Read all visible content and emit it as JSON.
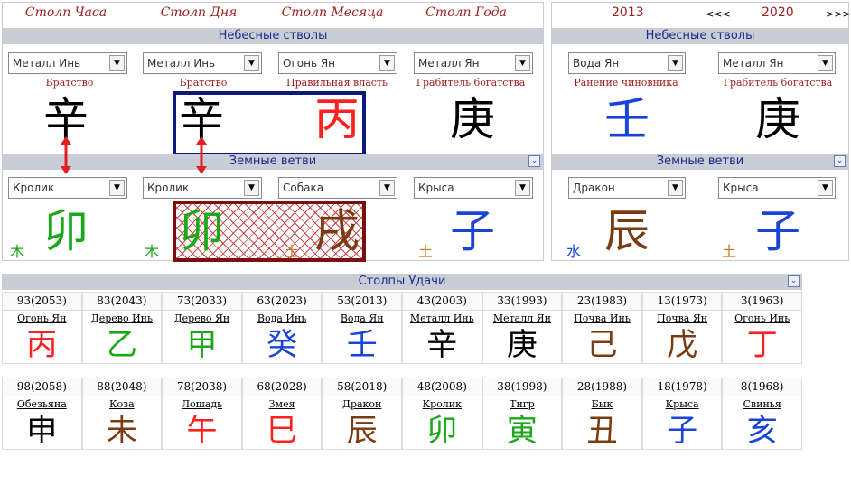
{
  "colors": {
    "header_bg": "#c9ced6",
    "title_red": "#a01e1e",
    "metal": "#000000",
    "fire": "#ff2020",
    "water": "#1a44d8",
    "wood": "#18a818",
    "earth": "#7a3b12"
  },
  "natal": {
    "pillars": [
      {
        "title": "Столп Часа",
        "stem_select": "Металл Инь",
        "god": "Братство",
        "stem_char": "辛",
        "stem_color": "#000000",
        "branch_select": "Кролик",
        "branch_char": "卯",
        "branch_color": "#18a818",
        "hidden": "木",
        "hidden_color": "#18a818"
      },
      {
        "title": "Столп Дня",
        "stem_select": "Металл Инь",
        "god": "Братство",
        "stem_char": "辛",
        "stem_color": "#000000",
        "branch_select": "Кролик",
        "branch_char": "卯",
        "branch_color": "#18a818",
        "hidden": "木",
        "hidden_color": "#18a818"
      },
      {
        "title": "Столп Месяца",
        "stem_select": "Огонь Ян",
        "god": "Правильная власть",
        "stem_char": "丙",
        "stem_color": "#ff2020",
        "branch_select": "Собака",
        "branch_char": "戌",
        "branch_color": "#7a3b12",
        "hidden": "土",
        "hidden_color": "#c07a18"
      },
      {
        "title": "Столп Года",
        "stem_select": "Металл Ян",
        "god": "Грабитель богатства",
        "stem_char": "庚",
        "stem_color": "#000000",
        "branch_select": "Крыса",
        "branch_char": "子",
        "branch_color": "#1a44d8",
        "hidden": "土",
        "hidden_color": "#c07a18"
      }
    ],
    "heavenly_header": "Небесные стволы",
    "earthly_header": "Земные ветви"
  },
  "annual": {
    "year_left": "2013",
    "nav_prev": "<<<",
    "year_right": "2020",
    "nav_next": ">>>",
    "heavenly_header": "Небесные стволы",
    "earthly_header": "Земные ветви",
    "pillars": [
      {
        "stem_select": "Вода Ян",
        "god": "Ранение чиновника",
        "stem_char": "壬",
        "stem_color": "#1a44d8",
        "branch_select": "Дракон",
        "branch_char": "辰",
        "branch_color": "#7a3b12",
        "hidden": "水",
        "hidden_color": "#1a44d8"
      },
      {
        "stem_select": "Металл Ян",
        "god": "Грабитель богатства",
        "stem_char": "庚",
        "stem_color": "#000000",
        "branch_select": "Крыса",
        "branch_char": "子",
        "branch_color": "#1a44d8",
        "hidden": "土",
        "hidden_color": "#c07a18"
      }
    ]
  },
  "luck": {
    "header": "Столпы Удачи",
    "stems": [
      {
        "age": "93(2053)",
        "name": "Огонь Ян",
        "char": "丙",
        "color": "#ff2020"
      },
      {
        "age": "83(2043)",
        "name": "Дерево Инь",
        "char": "乙",
        "color": "#18a818"
      },
      {
        "age": "73(2033)",
        "name": "Дерево Ян",
        "char": "甲",
        "color": "#18a818"
      },
      {
        "age": "63(2023)",
        "name": "Вода Инь",
        "char": "癸",
        "color": "#1a44d8"
      },
      {
        "age": "53(2013)",
        "name": "Вода Ян",
        "char": "壬",
        "color": "#1a44d8"
      },
      {
        "age": "43(2003)",
        "name": "Металл Инь",
        "char": "辛",
        "color": "#000000"
      },
      {
        "age": "33(1993)",
        "name": "Металл Ян",
        "char": "庚",
        "color": "#000000"
      },
      {
        "age": "23(1983)",
        "name": "Почва Инь",
        "char": "己",
        "color": "#7a3b12"
      },
      {
        "age": "13(1973)",
        "name": "Почва Ян",
        "char": "戊",
        "color": "#7a3b12"
      },
      {
        "age": "3(1963)",
        "name": "Огонь Инь",
        "char": "丁",
        "color": "#ff2020"
      }
    ],
    "branches": [
      {
        "age": "98(2058)",
        "name": "Обезьяна",
        "char": "申",
        "color": "#000000"
      },
      {
        "age": "88(2048)",
        "name": "Коза",
        "char": "未",
        "color": "#7a3b12"
      },
      {
        "age": "78(2038)",
        "name": "Лошадь",
        "char": "午",
        "color": "#ff2020"
      },
      {
        "age": "68(2028)",
        "name": "Змея",
        "char": "巳",
        "color": "#ff2020"
      },
      {
        "age": "58(2018)",
        "name": "Дракон",
        "char": "辰",
        "color": "#7a3b12"
      },
      {
        "age": "48(2008)",
        "name": "Кролик",
        "char": "卯",
        "color": "#18a818"
      },
      {
        "age": "38(1998)",
        "name": "Тигр",
        "char": "寅",
        "color": "#18a818"
      },
      {
        "age": "28(1988)",
        "name": "Бык",
        "char": "丑",
        "color": "#7a3b12"
      },
      {
        "age": "18(1978)",
        "name": "Крыса",
        "char": "子",
        "color": "#1a44d8"
      },
      {
        "age": "8(1968)",
        "name": "Свинья",
        "char": "亥",
        "color": "#1a44d8"
      }
    ]
  }
}
